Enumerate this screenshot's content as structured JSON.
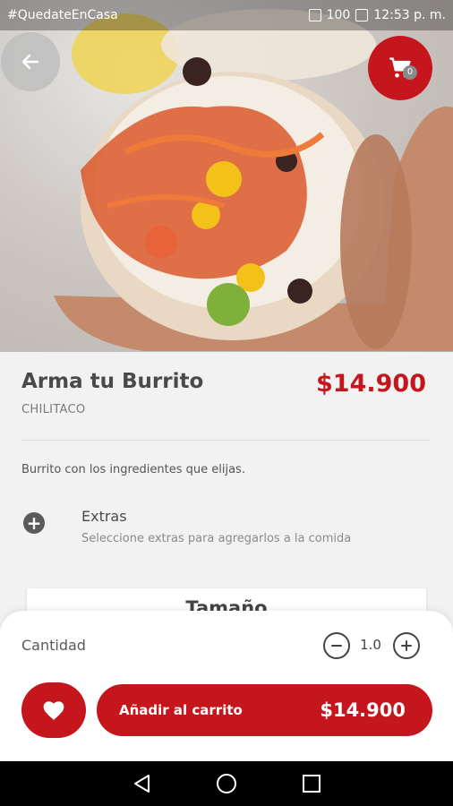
{
  "status_bar": {
    "left_text": "#QuedateEnCasa",
    "battery": "100",
    "time": "12:53 p. m."
  },
  "product": {
    "title": "Arma tu Burrito",
    "price": "$14.900",
    "brand": "CHILITACO",
    "description": "Burrito con los ingredientes que elijas."
  },
  "extras": {
    "title": "Extras",
    "subtitle": "Seleccione extras para agregarlos a la comida"
  },
  "size_section": {
    "title": "Tamaño"
  },
  "cart": {
    "count": "0"
  },
  "quantity": {
    "label": "Cantidad",
    "value": "1.0"
  },
  "add_to_cart": {
    "label": "Añadir al carrito",
    "price": "$14.900"
  },
  "icons": {
    "back": "arrow-left-icon",
    "cart": "cart-icon",
    "extras": "plus-circle-icon",
    "minus": "minus-circle-icon",
    "plus": "plus-circle-icon",
    "favorite": "heart-icon",
    "nav_back": "triangle-back-icon",
    "nav_home": "circle-home-icon",
    "nav_recent": "square-recent-icon"
  },
  "colors": {
    "accent": "#c4161c",
    "title_text": "#4a4a4a",
    "muted_text": "#7a7a7a"
  }
}
